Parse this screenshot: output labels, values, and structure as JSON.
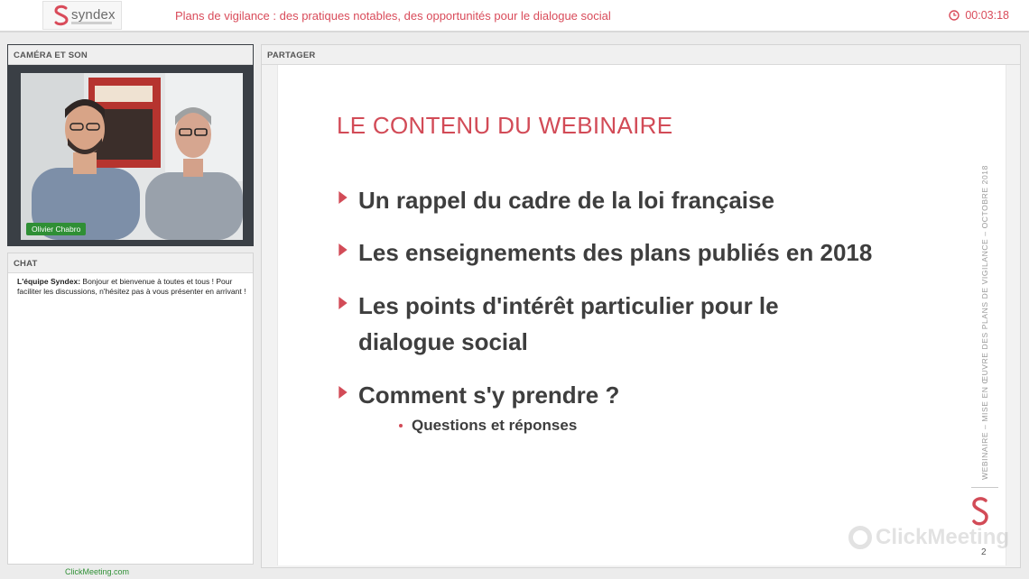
{
  "header": {
    "logo_text": "syndex",
    "meeting_title": "Plans de vigilance : des pratiques notables, des opportunités pour le dialogue social",
    "timer": "00:03:18",
    "accent_color": "#d94b5a"
  },
  "camera_panel": {
    "title": "CAMÉRA ET SON",
    "participant_name": "Olivier Chabro"
  },
  "chat_panel": {
    "title": "CHAT",
    "messages": [
      {
        "sender": "L'équipe Syndex:",
        "text": "Bonjour et bienvenue à toutes et tous ! Pour faciliter les discussions, n'hésitez pas à vous présenter en arrivant !"
      }
    ]
  },
  "share_panel": {
    "title": "PARTAGER",
    "slide": {
      "title": "LE CONTENU DU WEBINAIRE",
      "bullets": [
        "Un rappel du cadre de la loi française",
        "Les enseignements des plans publiés en 2018",
        "Les points d'intérêt particulier pour le",
        "dialogue social",
        "Comment s'y prendre ?"
      ],
      "sub_bullet": "Questions et réponses",
      "vertical_text": "WEBINAIRE – MISE EN ŒUVRE DES PLANS DE VIGILANCE – OCTOBRE 2018",
      "page_number": "2",
      "watermark": "ClickMeeting"
    }
  },
  "footer": {
    "link": "ClickMeeting.com"
  }
}
